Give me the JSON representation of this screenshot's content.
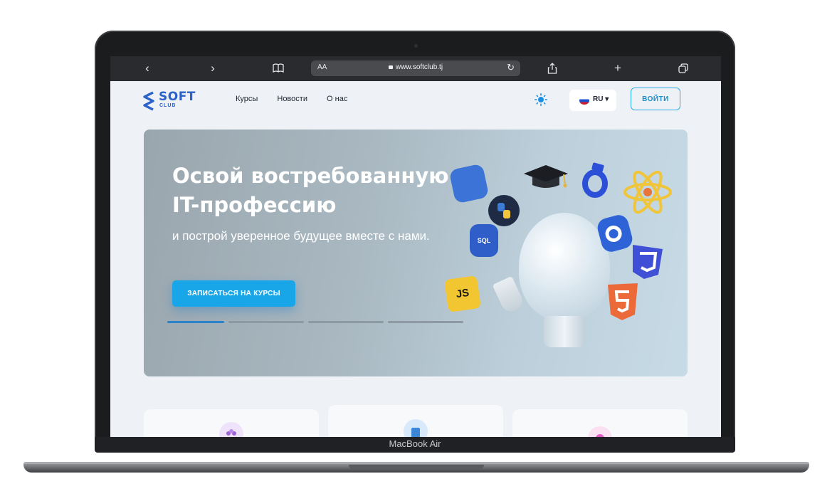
{
  "device": {
    "label": "MacBook Air"
  },
  "browser": {
    "url": "www.softclub.tj",
    "reader_label": "AA",
    "icons": {
      "back": "back-icon",
      "forward": "forward-icon",
      "bookmarks": "book-icon",
      "lock": "lock-icon",
      "reload": "reload-icon",
      "share": "share-icon",
      "new_tab": "plus-icon",
      "tabs": "tabs-icon"
    }
  },
  "site": {
    "logo": {
      "soft": "SOFT",
      "club": "CLUB"
    },
    "nav": [
      "Курсы",
      "Новости",
      "О нас"
    ],
    "language": "RU",
    "login_label": "ВОЙТИ",
    "hero": {
      "title_line1": "Освой востребованную",
      "title_line2": "IT-профессию",
      "subtitle": "и построй уверенное будущее вместе с нами.",
      "cta_label": "ЗАПИСАТЬСЯ НА КУРСЫ",
      "badges": {
        "sql": "SQL",
        "js": "JS"
      }
    },
    "colors": {
      "accent": "#18a6e9",
      "brand": "#2a62c9"
    }
  }
}
